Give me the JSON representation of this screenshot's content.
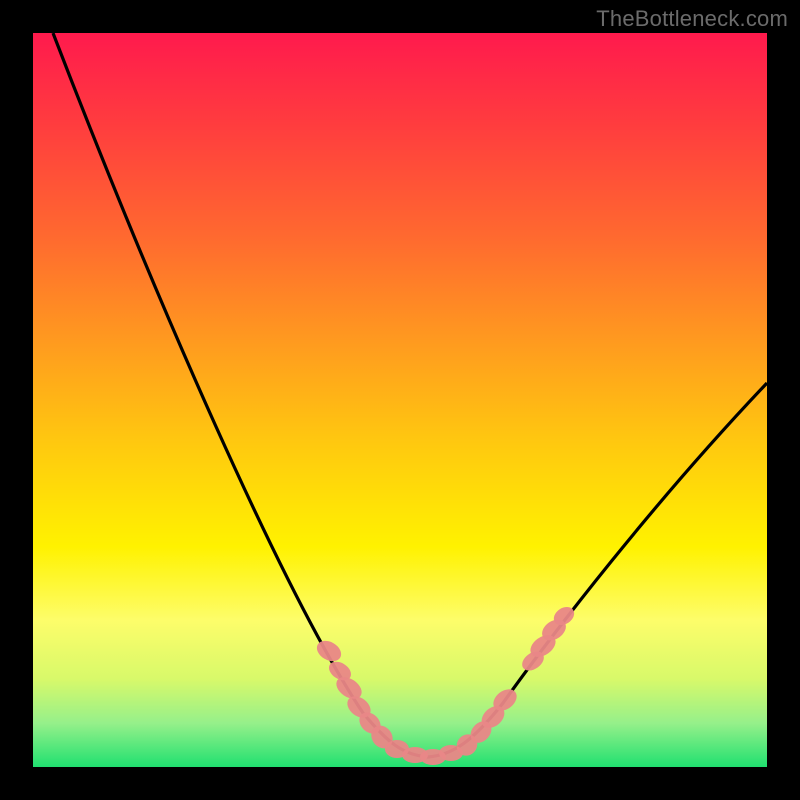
{
  "watermark": "TheBottleneck.com",
  "chart_data": {
    "type": "line",
    "title": "",
    "xlabel": "",
    "ylabel": "",
    "xlim": [
      0,
      100
    ],
    "ylim": [
      0,
      100
    ],
    "x": [
      3,
      10,
      20,
      30,
      37,
      42,
      46,
      49,
      52,
      55,
      58,
      62,
      67,
      74,
      82,
      90,
      100
    ],
    "values": [
      100,
      80,
      54,
      28,
      11,
      4,
      1,
      0,
      0,
      0,
      1,
      4,
      10,
      20,
      32,
      42,
      53
    ],
    "annotations": [
      {
        "type": "marker-cluster",
        "x_range": [
          37,
          67
        ],
        "y_range": [
          0,
          12
        ],
        "color": "#e98787"
      }
    ],
    "background": "heat-gradient"
  }
}
